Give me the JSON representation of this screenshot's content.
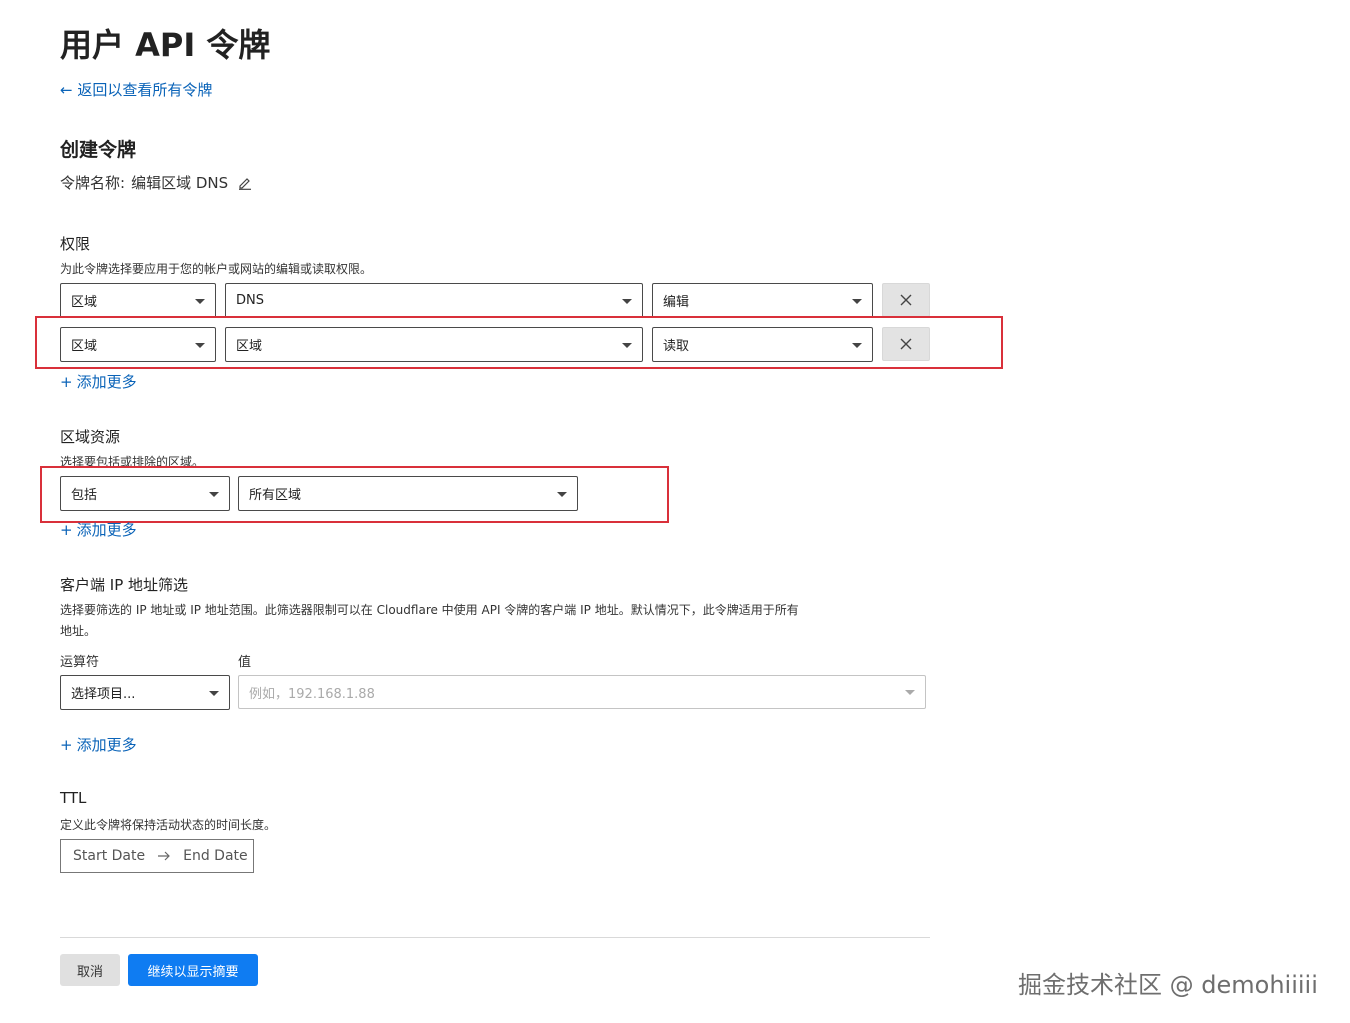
{
  "page": {
    "title": "用户 API 令牌",
    "back_link": "← 返回以查看所有令牌"
  },
  "create": {
    "title": "创建令牌",
    "token_name_label": "令牌名称:",
    "token_name_value": "编辑区域 DNS"
  },
  "permissions": {
    "title": "权限",
    "description": "为此令牌选择要应用于您的帐户或网站的编辑或读取权限。",
    "rows": [
      {
        "scope": "区域",
        "resource": "DNS",
        "access": "编辑"
      },
      {
        "scope": "区域",
        "resource": "区域",
        "access": "读取"
      }
    ],
    "add_more": "添加更多"
  },
  "zone_resources": {
    "title": "区域资源",
    "description": "选择要包括或排除的区域。",
    "include": "包括",
    "zones": "所有区域",
    "add_more": "添加更多"
  },
  "ip_filter": {
    "title": "客户端 IP 地址筛选",
    "description_line1": "选择要筛选的 IP 地址或 IP 地址范围。此筛选器限制可以在 Cloudflare 中使用 API 令牌的客户端 IP 地址。默认情况下，此令牌适用于所有",
    "description_line2": "地址。",
    "operator_label": "运算符",
    "value_label": "值",
    "operator_placeholder": "选择项目...",
    "value_placeholder": "例如，192.168.1.88",
    "add_more": "添加更多"
  },
  "ttl": {
    "title": "TTL",
    "description": "定义此令牌将保持活动状态的时间长度。",
    "start_date": "Start Date",
    "end_date": "End Date"
  },
  "actions": {
    "cancel": "取消",
    "continue": "继续以显示摘要"
  },
  "watermark": "掘金技术社区 @ demohiiiii",
  "colors": {
    "link": "#0a63b8",
    "primary": "#0f7cf2",
    "highlight": "#d9303a"
  }
}
